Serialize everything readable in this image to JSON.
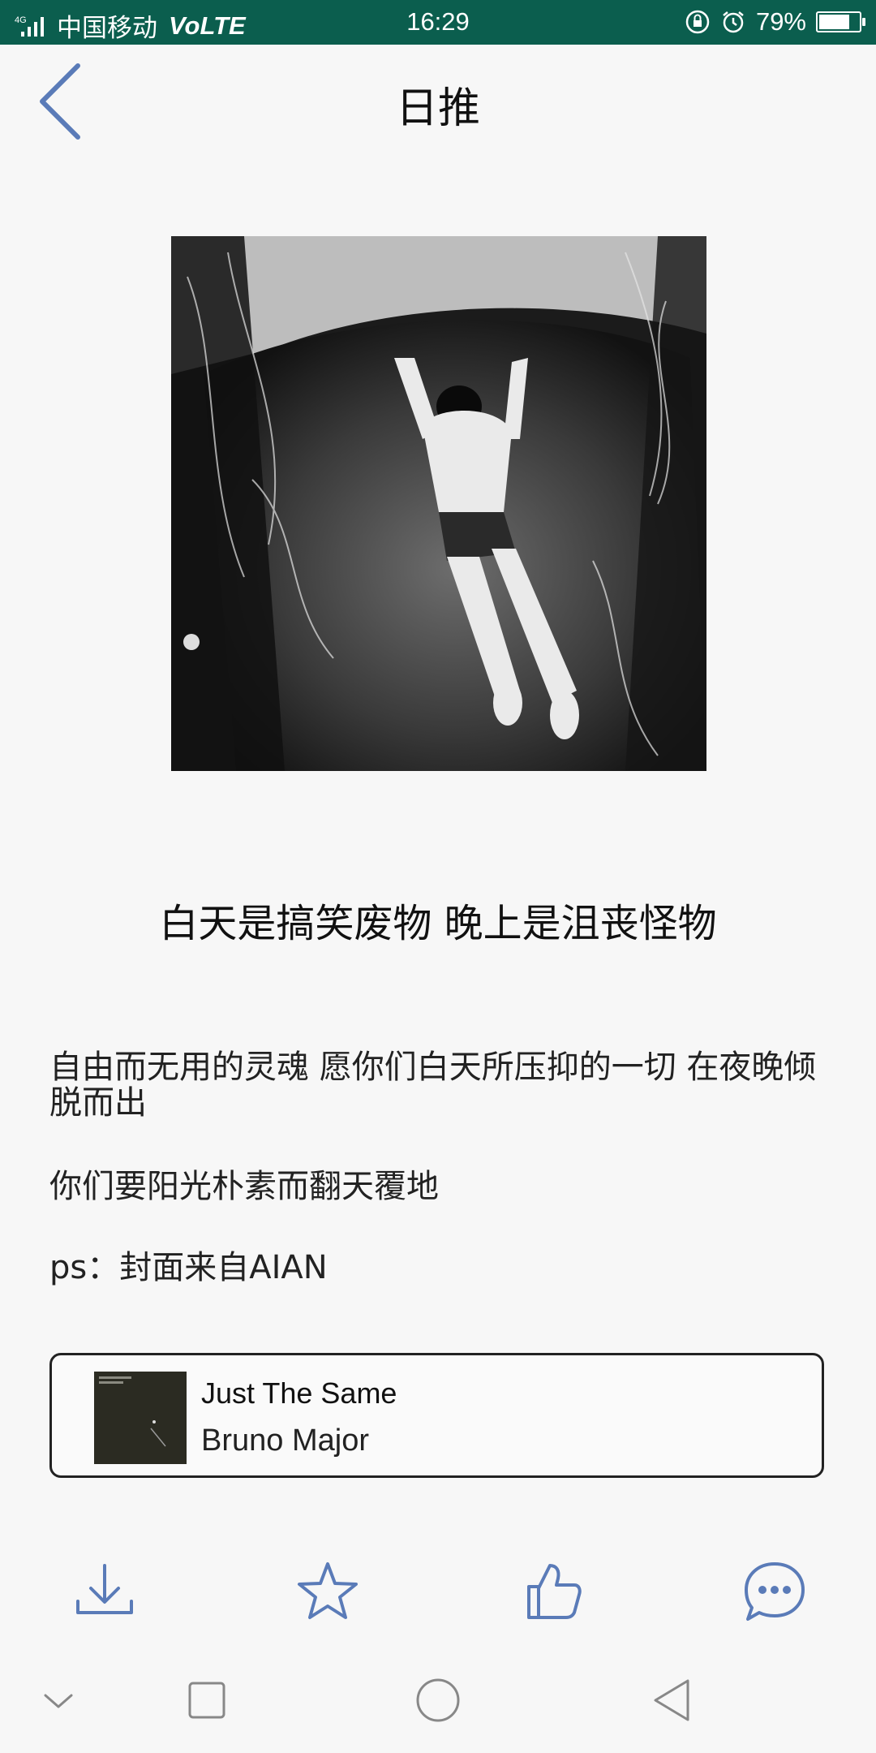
{
  "status_bar": {
    "network": "4G",
    "carrier": "中国移动",
    "volte": "VoLTE",
    "time": "16:29",
    "battery_percent": "79%",
    "battery_level": 0.79,
    "icons": [
      "signal-icon",
      "lock-rotation-icon",
      "alarm-icon",
      "battery-icon"
    ]
  },
  "header": {
    "title": "日推",
    "back_icon": "chevron-left-icon"
  },
  "post": {
    "headline": "白天是搞笑废物  晚上是沮丧怪物",
    "paragraphs": [
      "自由而无用的灵魂 愿你们白天所压抑的一切 在夜晚倾脱而出",
      "你们要阳光朴素而翻天覆地",
      "ps：封面来自AIAN"
    ]
  },
  "music_card": {
    "title": "Just The Same",
    "artist": "Bruno Major"
  },
  "actions": [
    {
      "name": "download-icon"
    },
    {
      "name": "star-icon"
    },
    {
      "name": "thumbs-up-icon"
    },
    {
      "name": "comment-icon"
    }
  ],
  "nav_bar": [
    "chevron-down-icon",
    "recent-apps-icon",
    "home-icon",
    "back-triangle-icon"
  ],
  "colors": {
    "status_bar": "#0b5e4e",
    "accent": "#5a7bb8",
    "background": "#f7f7f7"
  }
}
